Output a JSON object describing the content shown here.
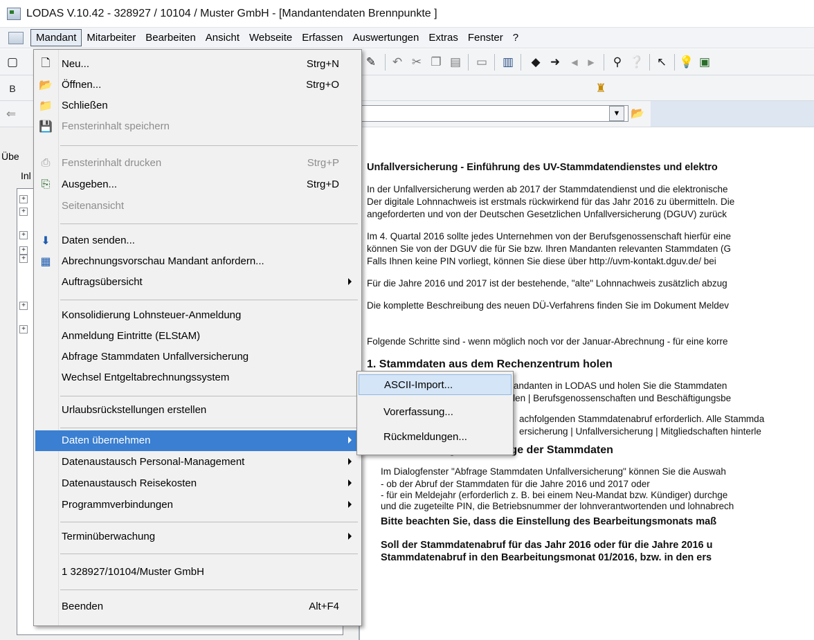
{
  "window": {
    "title": "LODAS V.10.42 - 328927 / 10104 / Muster GmbH - [Mandantendaten Brennpunkte ]"
  },
  "menubar": {
    "items": [
      "Mandant",
      "Mitarbeiter",
      "Bearbeiten",
      "Ansicht",
      "Webseite",
      "Erfassen",
      "Auswertungen",
      "Extras",
      "Fenster",
      "?"
    ]
  },
  "left_panel": {
    "header_label": "Übe",
    "tab_label": "Inl"
  },
  "dropdown": {
    "items": [
      {
        "label": "Neu...",
        "shortcut": "Strg+N",
        "icon": "new-document-icon"
      },
      {
        "label": "Öffnen...",
        "shortcut": "Strg+O",
        "icon": "open-folder-icon"
      },
      {
        "label": "Schließen",
        "shortcut": "",
        "icon": "close-folder-icon"
      },
      {
        "label": "Fensterinhalt speichern",
        "shortcut": "",
        "icon": "save-disk-icon",
        "disabled": true
      },
      {
        "label": "Fensterinhalt drucken",
        "shortcut": "Strg+P",
        "icon": "printer-icon",
        "disabled": true
      },
      {
        "label": "Ausgeben...",
        "shortcut": "Strg+D",
        "icon": "output-icon"
      },
      {
        "label": "Seitenansicht",
        "shortcut": "",
        "icon": "",
        "disabled": true
      },
      {
        "label": "Daten senden...",
        "shortcut": "",
        "icon": "send-data-icon"
      },
      {
        "label": "Abrechnungsvorschau Mandant anfordern...",
        "shortcut": "",
        "icon": "preview-request-icon"
      },
      {
        "label": "Auftragsübersicht",
        "shortcut": "",
        "icon": "",
        "submenu": true
      },
      {
        "label": "Konsolidierung Lohnsteuer-Anmeldung",
        "shortcut": "",
        "icon": ""
      },
      {
        "label": "Anmeldung Eintritte (ELStAM)",
        "shortcut": "",
        "icon": ""
      },
      {
        "label": "Abfrage Stammdaten Unfallversicherung",
        "shortcut": "",
        "icon": ""
      },
      {
        "label": "Wechsel Entgeltabrechnungssystem",
        "shortcut": "",
        "icon": ""
      },
      {
        "label": "Urlaubsrückstellungen erstellen",
        "shortcut": "",
        "icon": ""
      },
      {
        "label": "Daten übernehmen",
        "shortcut": "",
        "icon": "",
        "submenu": true,
        "highlighted": true
      },
      {
        "label": "Datenaustausch Personal-Management",
        "shortcut": "",
        "icon": "",
        "submenu": true
      },
      {
        "label": "Datenaustausch Reisekosten",
        "shortcut": "",
        "icon": "",
        "submenu": true
      },
      {
        "label": "Programmverbindungen",
        "shortcut": "",
        "icon": "",
        "submenu": true
      },
      {
        "label": "Terminüberwachung",
        "shortcut": "",
        "icon": "",
        "submenu": true
      },
      {
        "label": "1 328927/10104/Muster GmbH",
        "shortcut": "",
        "icon": ""
      },
      {
        "label": "Beenden",
        "shortcut": "Alt+F4",
        "icon": ""
      }
    ]
  },
  "submenu": {
    "items": [
      "ASCII-Import...",
      "Vorerfassung...",
      "Rückmeldungen..."
    ]
  },
  "document": {
    "lines": [
      "Unfallversicherung - Einführung des UV-Stammdatendienstes und elektro",
      "In der Unfallversicherung werden ab 2017 der Stammdatendienst und die elektronische",
      "Der digitale Lohnnachweis ist erstmals rückwirkend für das Jahr 2016 zu übermitteln. Die",
      "angeforderten und von der Deutschen Gesetzlichen Unfallversicherung (DGUV) zurück",
      "Im 4. Quartal 2016 sollte jedes Unternehmen von der Berufsgenossenschaft hierfür eine",
      "können Sie von der DGUV die für Sie bzw. Ihren Mandanten relevanten Stammdaten (G",
      "Falls Ihnen keine PIN vorliegt, können Sie diese über http://uvm-kontakt.dguv.de/ bei",
      "Für die Jahre 2016 und 2017 ist der bestehende, \"alte\" Lohnnachweis zusätzlich abzug",
      "Die komplette Beschreibung des neuen DÜ-Verfahrens finden Sie im Dokument Meldev",
      "Folgende Schritte sind -  wenn möglich noch vor der Januar-Abrechnung - für eine korre",
      "1. Stammdaten aus dem Rechenzentrum holen",
      "Schließen Sie den geöffneten Mandanten in LODAS und holen Sie die Stammdaten",
      "Wählen Sie Mandant | Daten holen | Berufsgenossenschaften und Beschäftigungsbe",
      "achfolgenden Stammdatenabruf erforderlich. Alle Stammda",
      "ersicherung | Unfallversicherung | Mitgliedschaften hinterle",
      "2. PIN-Erfassung und Abfrage der Stammdaten",
      "Im Dialogfenster \"Abfrage Stammdaten Unfallversicherung\"  können Sie die Auswah",
      "-   ob der Abruf der Stammdaten für die Jahre 2016 und 2017 oder",
      "-   für ein Meldejahr (erforderlich z. B. bei einem Neu-Mandat bzw. Kündiger) durchge",
      "und die zugeteilte PIN, die Betriebsnummer der lohnverantwortenden und lohnabrech",
      "Bitte beachten Sie, dass die Einstellung des Bearbeitungsmonats maß",
      "Soll der Stammdatenabruf für das Jahr 2016 oder für die Jahre 2016 u",
      "Stammdatenabruf in den Bearbeitungsmonat 01/2016, bzw. in den ers"
    ]
  },
  "colors": {
    "highlight": "#3a7fd1",
    "menu_background": "#f1f1f1"
  }
}
